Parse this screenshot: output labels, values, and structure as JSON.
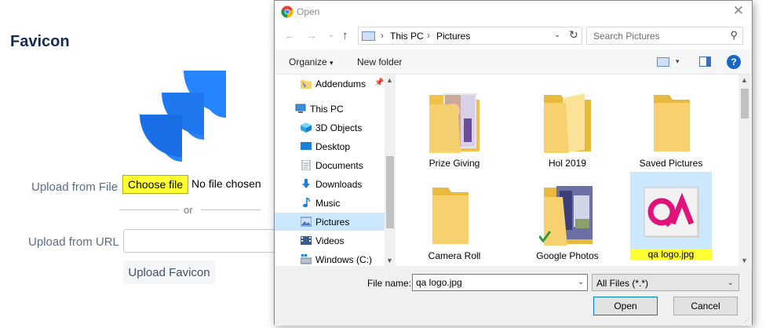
{
  "page": {
    "title": "Favicon",
    "upload_file_label": "Upload from File",
    "choose_file_label": "Choose file",
    "no_file_text": "No file chosen",
    "or_text": "or",
    "upload_url_label": "Upload from URL",
    "url_value": "",
    "upload_button_label": "Upload Favicon",
    "logo_icon": "jira-software-logo",
    "colors": {
      "accent": "#2684ff",
      "highlight": "#ffff33",
      "text": "#172b4d"
    }
  },
  "dialog": {
    "title": "Open",
    "title_icon": "chrome-icon",
    "breadcrumb": [
      "This PC",
      "Pictures"
    ],
    "search_placeholder": "Search Pictures",
    "toolbar": {
      "organize": "Organize",
      "new_folder": "New folder"
    },
    "nav": [
      {
        "label": "Addendums",
        "icon": "folder-pinned-icon"
      },
      {
        "label": "This PC",
        "icon": "computer-icon"
      },
      {
        "label": "3D Objects",
        "icon": "3d-objects-icon"
      },
      {
        "label": "Desktop",
        "icon": "desktop-icon"
      },
      {
        "label": "Documents",
        "icon": "documents-icon"
      },
      {
        "label": "Downloads",
        "icon": "downloads-icon"
      },
      {
        "label": "Music",
        "icon": "music-icon"
      },
      {
        "label": "Pictures",
        "icon": "pictures-icon",
        "selected": true
      },
      {
        "label": "Videos",
        "icon": "videos-icon"
      },
      {
        "label": "Windows (C:)",
        "icon": "drive-icon"
      }
    ],
    "files": [
      {
        "label": "Prize Giving",
        "type": "folder"
      },
      {
        "label": "Hol 2019",
        "type": "folder"
      },
      {
        "label": "Saved Pictures",
        "type": "folder"
      },
      {
        "label": "Camera Roll",
        "type": "folder"
      },
      {
        "label": "Google Photos",
        "type": "folder"
      },
      {
        "label": "qa logo.jpg",
        "type": "image",
        "selected": true
      }
    ],
    "file_name_label": "File name:",
    "file_name_value": "qa logo.jpg",
    "file_type_value": "All Files (*.*)",
    "open_label": "Open",
    "cancel_label": "Cancel"
  }
}
